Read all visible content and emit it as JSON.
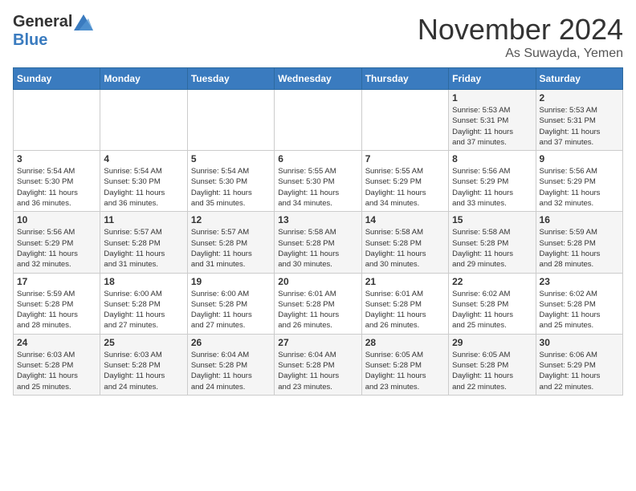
{
  "header": {
    "logo_general": "General",
    "logo_blue": "Blue",
    "month_title": "November 2024",
    "location": "As Suwayda, Yemen"
  },
  "weekdays": [
    "Sunday",
    "Monday",
    "Tuesday",
    "Wednesday",
    "Thursday",
    "Friday",
    "Saturday"
  ],
  "weeks": [
    [
      {
        "day": "",
        "info": ""
      },
      {
        "day": "",
        "info": ""
      },
      {
        "day": "",
        "info": ""
      },
      {
        "day": "",
        "info": ""
      },
      {
        "day": "",
        "info": ""
      },
      {
        "day": "1",
        "info": "Sunrise: 5:53 AM\nSunset: 5:31 PM\nDaylight: 11 hours\nand 37 minutes."
      },
      {
        "day": "2",
        "info": "Sunrise: 5:53 AM\nSunset: 5:31 PM\nDaylight: 11 hours\nand 37 minutes."
      }
    ],
    [
      {
        "day": "3",
        "info": "Sunrise: 5:54 AM\nSunset: 5:30 PM\nDaylight: 11 hours\nand 36 minutes."
      },
      {
        "day": "4",
        "info": "Sunrise: 5:54 AM\nSunset: 5:30 PM\nDaylight: 11 hours\nand 36 minutes."
      },
      {
        "day": "5",
        "info": "Sunrise: 5:54 AM\nSunset: 5:30 PM\nDaylight: 11 hours\nand 35 minutes."
      },
      {
        "day": "6",
        "info": "Sunrise: 5:55 AM\nSunset: 5:30 PM\nDaylight: 11 hours\nand 34 minutes."
      },
      {
        "day": "7",
        "info": "Sunrise: 5:55 AM\nSunset: 5:29 PM\nDaylight: 11 hours\nand 34 minutes."
      },
      {
        "day": "8",
        "info": "Sunrise: 5:56 AM\nSunset: 5:29 PM\nDaylight: 11 hours\nand 33 minutes."
      },
      {
        "day": "9",
        "info": "Sunrise: 5:56 AM\nSunset: 5:29 PM\nDaylight: 11 hours\nand 32 minutes."
      }
    ],
    [
      {
        "day": "10",
        "info": "Sunrise: 5:56 AM\nSunset: 5:29 PM\nDaylight: 11 hours\nand 32 minutes."
      },
      {
        "day": "11",
        "info": "Sunrise: 5:57 AM\nSunset: 5:28 PM\nDaylight: 11 hours\nand 31 minutes."
      },
      {
        "day": "12",
        "info": "Sunrise: 5:57 AM\nSunset: 5:28 PM\nDaylight: 11 hours\nand 31 minutes."
      },
      {
        "day": "13",
        "info": "Sunrise: 5:58 AM\nSunset: 5:28 PM\nDaylight: 11 hours\nand 30 minutes."
      },
      {
        "day": "14",
        "info": "Sunrise: 5:58 AM\nSunset: 5:28 PM\nDaylight: 11 hours\nand 30 minutes."
      },
      {
        "day": "15",
        "info": "Sunrise: 5:58 AM\nSunset: 5:28 PM\nDaylight: 11 hours\nand 29 minutes."
      },
      {
        "day": "16",
        "info": "Sunrise: 5:59 AM\nSunset: 5:28 PM\nDaylight: 11 hours\nand 28 minutes."
      }
    ],
    [
      {
        "day": "17",
        "info": "Sunrise: 5:59 AM\nSunset: 5:28 PM\nDaylight: 11 hours\nand 28 minutes."
      },
      {
        "day": "18",
        "info": "Sunrise: 6:00 AM\nSunset: 5:28 PM\nDaylight: 11 hours\nand 27 minutes."
      },
      {
        "day": "19",
        "info": "Sunrise: 6:00 AM\nSunset: 5:28 PM\nDaylight: 11 hours\nand 27 minutes."
      },
      {
        "day": "20",
        "info": "Sunrise: 6:01 AM\nSunset: 5:28 PM\nDaylight: 11 hours\nand 26 minutes."
      },
      {
        "day": "21",
        "info": "Sunrise: 6:01 AM\nSunset: 5:28 PM\nDaylight: 11 hours\nand 26 minutes."
      },
      {
        "day": "22",
        "info": "Sunrise: 6:02 AM\nSunset: 5:28 PM\nDaylight: 11 hours\nand 25 minutes."
      },
      {
        "day": "23",
        "info": "Sunrise: 6:02 AM\nSunset: 5:28 PM\nDaylight: 11 hours\nand 25 minutes."
      }
    ],
    [
      {
        "day": "24",
        "info": "Sunrise: 6:03 AM\nSunset: 5:28 PM\nDaylight: 11 hours\nand 25 minutes."
      },
      {
        "day": "25",
        "info": "Sunrise: 6:03 AM\nSunset: 5:28 PM\nDaylight: 11 hours\nand 24 minutes."
      },
      {
        "day": "26",
        "info": "Sunrise: 6:04 AM\nSunset: 5:28 PM\nDaylight: 11 hours\nand 24 minutes."
      },
      {
        "day": "27",
        "info": "Sunrise: 6:04 AM\nSunset: 5:28 PM\nDaylight: 11 hours\nand 23 minutes."
      },
      {
        "day": "28",
        "info": "Sunrise: 6:05 AM\nSunset: 5:28 PM\nDaylight: 11 hours\nand 23 minutes."
      },
      {
        "day": "29",
        "info": "Sunrise: 6:05 AM\nSunset: 5:28 PM\nDaylight: 11 hours\nand 22 minutes."
      },
      {
        "day": "30",
        "info": "Sunrise: 6:06 AM\nSunset: 5:29 PM\nDaylight: 11 hours\nand 22 minutes."
      }
    ]
  ]
}
